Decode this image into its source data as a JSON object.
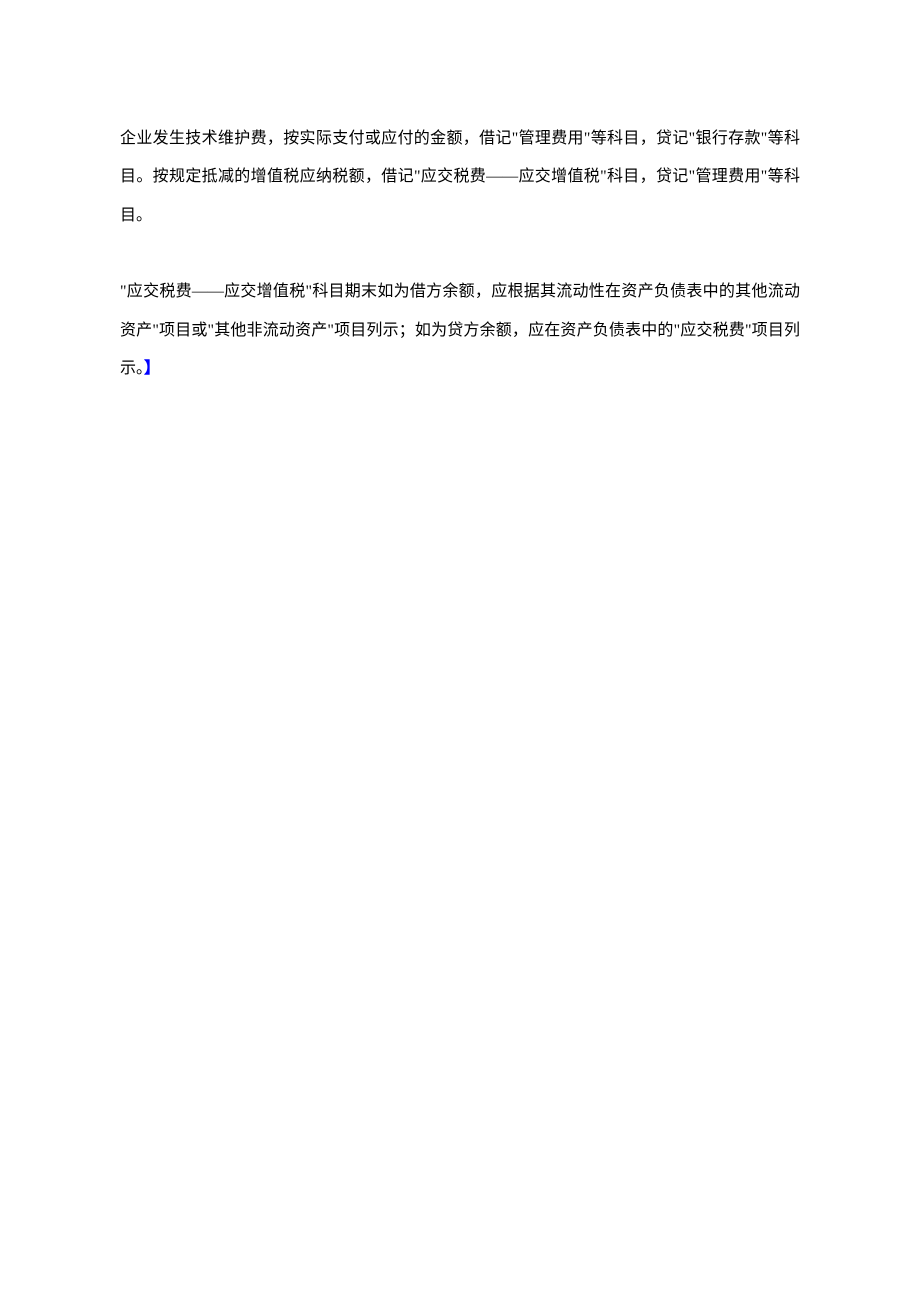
{
  "paragraphs": [
    {
      "text": "企业发生技术维护费，按实际支付或应付的金额，借记\"管理费用\"等科目，贷记\"银行存款\"等科目。按规定抵减的增值税应纳税额，借记\"应交税费——应交增值税\"科目，贷记\"管理费用\"等科目。"
    },
    {
      "text": "\"应交税费——应交增值税\"科目期末如为借方余额，应根据其流动性在资产负债表中的其他流动资产\"项目或\"其他非流动资产\"项目列示；如为贷方余额，应在资产负债表中的\"应交税费\"项目列示。",
      "endMark": "】"
    }
  ]
}
